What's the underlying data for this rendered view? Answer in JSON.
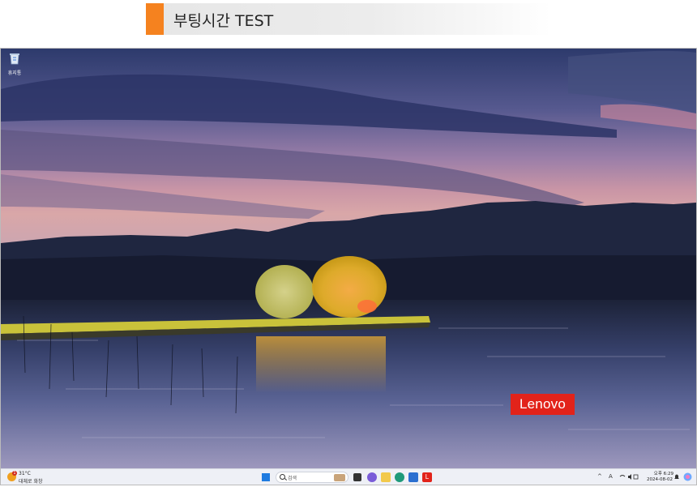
{
  "banner": {
    "title": "부팅시간 TEST",
    "accent": "#f5821f"
  },
  "desktop": {
    "icons": [
      {
        "label": "휴지통",
        "icon": "recycle-bin-icon"
      }
    ],
    "brand_badge": {
      "text": "Lenovo",
      "color": "#e2231a"
    }
  },
  "taskbar": {
    "weather": {
      "temp": "31°C",
      "text": "대체로 화창",
      "alert": "1"
    },
    "search": {
      "placeholder": "검색"
    },
    "pinned_apps": [
      "task-view-icon",
      "copilot-icon",
      "file-explorer-icon",
      "edge-icon",
      "store-icon",
      "lenovo-app-icon"
    ],
    "tray": {
      "chevron": "^",
      "ime": "A",
      "time": "오후 6:29",
      "date": "2024-08-02"
    }
  }
}
